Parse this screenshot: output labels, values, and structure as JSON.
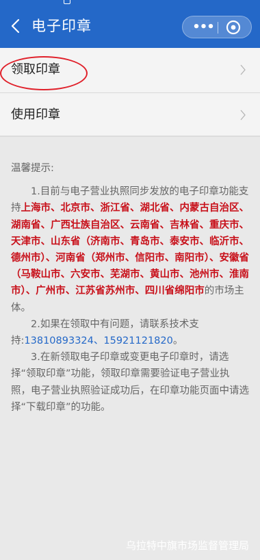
{
  "nav": {
    "title": "电子印章",
    "more": "•••"
  },
  "menu": [
    {
      "label": "领取印章"
    },
    {
      "label": "使用印章"
    }
  ],
  "tips": {
    "title": "温馨提示:",
    "p1_prefix": "1.目前与电子营业执照同步发放的电子印章功能支持",
    "p1_regions": "上海市、北京市、浙江省、湖北省、内蒙古自治区、湖南省、广西壮族自治区、云南省、吉林省、重庆市、天津市、山东省（济南市、青岛市、泰安市、临沂市、德州市）、河南省（郑州市、信阳市、南阳市）、安徽省（马鞍山市、六安市、芜湖市、黄山市、池州市、淮南市）、广州市、江苏省苏州市、四川省绵阳市",
    "p1_suffix": "的市场主体。",
    "p2_prefix": "2.如果在领取中有问题，请联系技术支持:",
    "phone1": "13810893324",
    "sep": "、",
    "phone2": "15921121820",
    "p2_suffix": "。",
    "p3": "3.在新领取电子印章或变更电子印章时，请选择“领取印章”功能，领取印章需要验证电子营业执照，电子营业执照验证成功后，在印章功能页面中请选择“下载印章”的功能。"
  },
  "footer": "乌拉特中旗市场监督管理局",
  "colors": {
    "brand": "#2468c8",
    "highlight": "#c8101a",
    "annotation": "#e0202a"
  }
}
